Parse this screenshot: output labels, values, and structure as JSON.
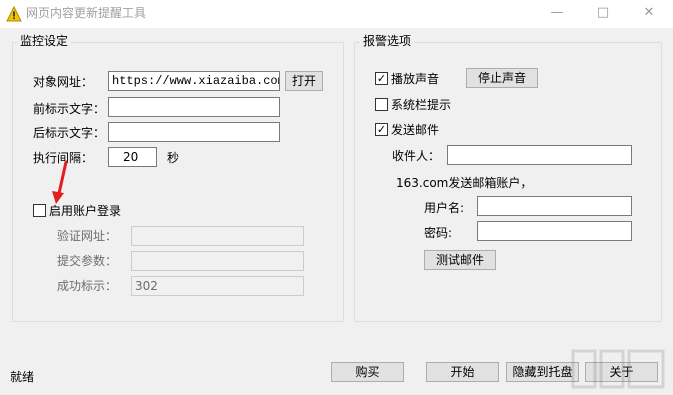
{
  "window": {
    "title": "网页内容更新提醒工具",
    "minimize_icon": "minimize-icon",
    "maximize_icon": "maximize-icon",
    "close_icon": "close-icon"
  },
  "monitor_group": {
    "title": "监控设定",
    "target_url_label": "对象网址：",
    "target_url_value": "https://www.xiazaiba.com/",
    "open_button": "打开",
    "prefix_text_label": "前标示文字：",
    "prefix_text_value": "",
    "suffix_text_label": "后标示文字：",
    "suffix_text_value": "",
    "interval_label": "执行间隔：",
    "interval_value": "20",
    "interval_unit": "秒",
    "enable_account_label": "启用账户登录",
    "enable_account_checked": false,
    "verify_url_label": "验证网址：",
    "verify_url_value": "",
    "submit_params_label": "提交参数：",
    "submit_params_value": "",
    "success_mark_label": "成功标示：",
    "success_mark_value": "302"
  },
  "alarm_group": {
    "title": "报警选项",
    "play_sound_label": "播放声音",
    "play_sound_checked": true,
    "stop_sound_button": "停止声音",
    "tray_tip_label": "系统栏提示",
    "tray_tip_checked": false,
    "send_mail_label": "发送邮件",
    "send_mail_checked": true,
    "recipient_label": "收件人：",
    "recipient_value": "",
    "sender_note": "163.com发送邮箱账户，",
    "username_label": "用户名:",
    "username_value": "",
    "password_label": "密码:",
    "password_value": "",
    "test_mail_button": "测试邮件"
  },
  "footer": {
    "status_text": "就绪",
    "buy_button": "购买",
    "start_button": "开始",
    "hide_tray_button": "隐藏到托盘",
    "about_button": "关于"
  },
  "colors": {
    "annotation_arrow": "#e02020",
    "window_background": "#f0f0f0"
  }
}
